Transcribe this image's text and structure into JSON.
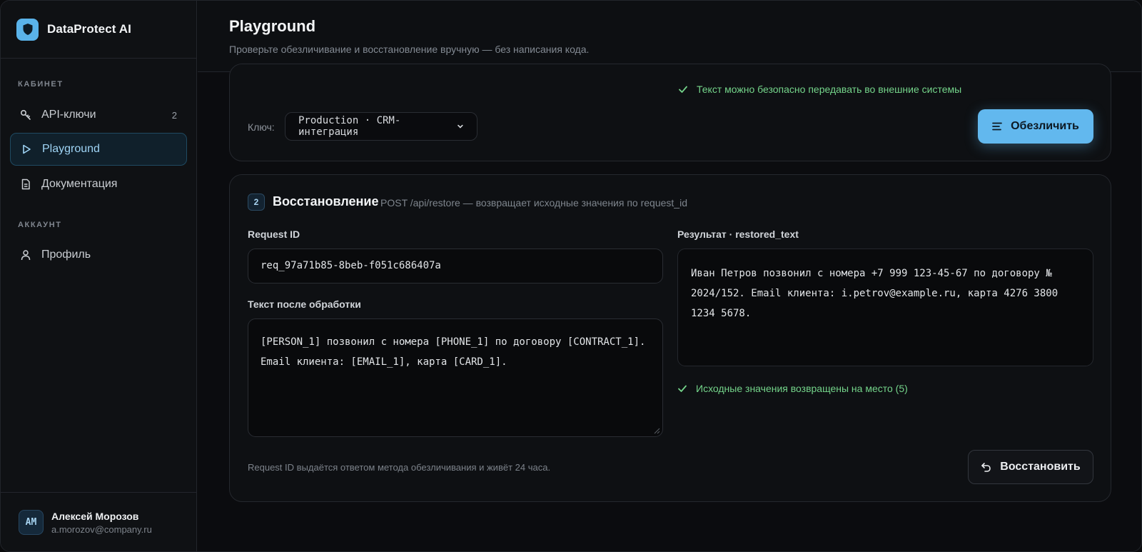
{
  "app": {
    "name": "DataProtect AI"
  },
  "sidebar": {
    "section_cabinet": "КАБИНЕТ",
    "section_account": "АККАУНТ",
    "items": [
      {
        "label": "API-ключи",
        "icon": "key-icon",
        "badge": "2"
      },
      {
        "label": "Playground",
        "icon": "play-icon",
        "active": true
      },
      {
        "label": "Документация",
        "icon": "document-icon"
      },
      {
        "label": "Профиль",
        "icon": "user-icon"
      }
    ],
    "user": {
      "initials": "АМ",
      "name": "Алексей Морозов",
      "email": "a.morozov@company.ru"
    }
  },
  "header": {
    "title": "Playground",
    "subtitle": "Проверьте обезличивание и восстановление вручную — без написания кода."
  },
  "anonymize": {
    "status": "Текст можно безопасно передавать во внешние системы",
    "key_label": "Ключ:",
    "key_value": "Production · CRM-интеграция",
    "button_label": "Обезличить"
  },
  "restore": {
    "step": "2",
    "title": "Восстановление",
    "hint": "POST /api/restore — возвращает исходные значения по request_id",
    "request_id_label": "Request ID",
    "request_id_value": "req_97a71b85-8beb-f051c686407a",
    "processed_label": "Текст после обработки",
    "processed_text": "[PERSON_1] позвонил с номера [PHONE_1] по договору [CONTRACT_1]. Email клиента: [EMAIL_1], карта [CARD_1].",
    "result_label": "Результат · restored_text",
    "result_text": "Иван Петров позвонил с номера +7 999 123-45-67 по договору № 2024/152. Email клиента: i.petrov@example.ru, карта 4276 3800 1234 5678.",
    "status": "Исходные значения возвращены на место (5)",
    "footnote": "Request ID выдаётся ответом метода обезличивания и живёт 24 часа.",
    "button_label": "Восстановить"
  },
  "colors": {
    "accent": "#62b8ee",
    "success": "#74d48a",
    "background": "#0b0c0f"
  }
}
